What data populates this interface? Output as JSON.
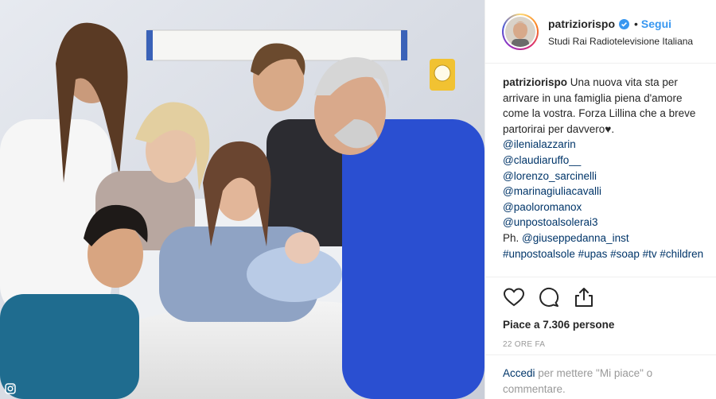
{
  "post": {
    "photo_alt_icon": "instagram-glyph-icon"
  },
  "header": {
    "username": "patriziorispo",
    "verified_icon": "verified-badge-icon",
    "dot": "•",
    "follow_label": "Segui",
    "location": "Studi Rai Radiotelevisione Italiana"
  },
  "caption": {
    "username": "patriziorispo",
    "lines": [
      " Una nuova vita sta per",
      "arrivare in una famiglia piena d'amore",
      "come la vostra. Forza Lillina che a breve",
      "partorirai per davvero♥."
    ],
    "mentions": [
      "@ilenialazzarin",
      "@claudiaruffo__",
      "@lorenzo_sarcinelli",
      "@marinagiuliacavalli",
      "@paoloromanox",
      "@unpostoalsolerai3"
    ],
    "photo_credit_prefix": "Ph. ",
    "photo_credit_handle": "@giuseppedanna_inst",
    "hashtags": "#unpostoalsole #upas #soap #tv #children"
  },
  "actions": {
    "like_icon": "heart-icon",
    "comment_icon": "comment-bubble-icon",
    "share_icon": "share-upload-icon"
  },
  "likes": {
    "text": "Piace a 7.306 persone"
  },
  "time": {
    "text": "22 ORE FA"
  },
  "footer": {
    "login_label": "Accedi",
    "rest_line1": " per mettere \"Mi piace\" o",
    "rest_line2": "commentare."
  },
  "colors": {
    "link": "#003569",
    "follow": "#3897f0",
    "muted": "#999999"
  }
}
